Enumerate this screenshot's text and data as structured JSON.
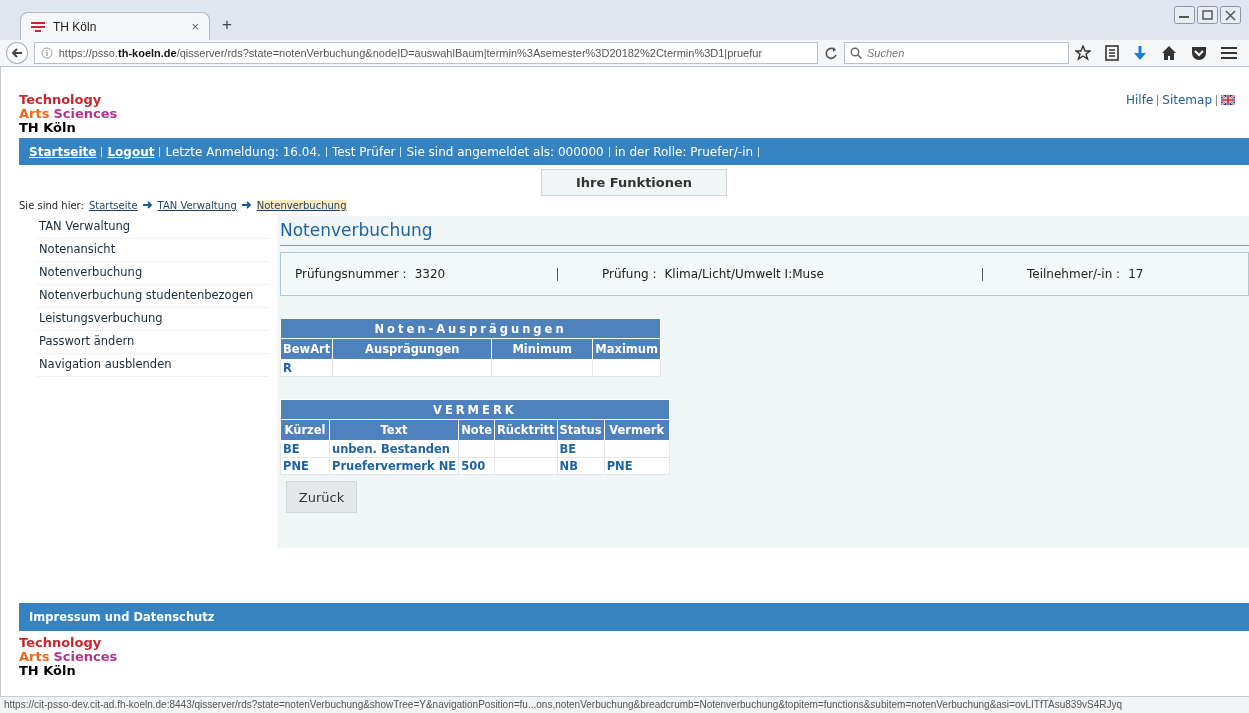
{
  "browser": {
    "tab_title": "TH Köln",
    "tab_close": "×",
    "new_tab": "+",
    "url": "https://psso.**th-koeln.de**/qisserver/rds?state=notenVerbuchung&nodeID=auswahlBaum|termin%3Asemester%3D20182%2Ctermin%3D1|pruefur",
    "search": {
      "placeholder": "Suchen"
    }
  },
  "logo": {
    "line1": "Technology",
    "word_arts": "Arts",
    "word_sciences": "Sciences",
    "name": "TH Köln"
  },
  "footer_logo": {
    "line1": "Technology",
    "word_arts": "Arts",
    "word_sciences": "Sciences",
    "name": "TH Köln"
  },
  "header_links": [
    "Hilfe",
    "Sitemap"
  ],
  "nav_bar": [
    {
      "kind": "link",
      "text": "Startseite"
    },
    {
      "kind": "link",
      "text": "Logout"
    },
    {
      "kind": "info",
      "text": "Letzte Anmeldung:  16.04."
    },
    {
      "kind": "info",
      "text": "Test Prüfer"
    },
    {
      "kind": "info",
      "text": "Sie sind angemeldet als: 000000"
    },
    {
      "kind": "info",
      "text": "in der Rolle: Pruefer/-in"
    }
  ],
  "functions_button": "Ihre Funktionen",
  "breadcrumb": {
    "label": "Sie sind hier:",
    "items": [
      {
        "text": "Startseite",
        "current": false
      },
      {
        "text": "TAN Verwaltung",
        "current": false
      },
      {
        "text": "Notenverbuchung",
        "current": true
      }
    ]
  },
  "sidebar": {
    "items": [
      "TAN Verwaltung",
      "Notenansicht",
      "Notenverbuchung",
      "Notenverbuchung studentenbezogen",
      "Leistungsverbuchung",
      "Passwort ändern",
      "Navigation ausblenden"
    ]
  },
  "content": {
    "title": "Notenverbuchung",
    "info": [
      {
        "label": "Prüfungsnummer :",
        "value": "3320"
      },
      {
        "label": "Prüfung :",
        "value": "Klima/Licht/Umwelt I:Muse"
      },
      {
        "label": "Teilnehmer/-in :",
        "value": "17"
      }
    ],
    "tables": [
      {
        "title": "Noten-Ausprägungen",
        "columns": [
          "BewArt",
          "Ausprägungen",
          "Minimum",
          "Maximum"
        ],
        "rows": [
          [
            "R",
            "",
            "",
            ""
          ]
        ]
      },
      {
        "title": "VERMERK",
        "columns": [
          "Kürzel",
          "Text",
          "Note",
          "Rücktritt",
          "Status",
          "Vermerk"
        ],
        "rows": [
          [
            "BE",
            "unben. Bestanden",
            "",
            "",
            "BE",
            ""
          ],
          [
            "PNE",
            "Pruefervermerk NE",
            "500",
            "",
            "NB",
            "PNE"
          ]
        ]
      }
    ],
    "back_button": "Zurück"
  },
  "footer": {
    "bar": "Impressum und Datenschutz"
  },
  "status_bar": "https://cit-psso-dev.cit-ad.fh-koeln.de:8443/qisserver/rds?state=notenVerbuchung&showTree=Y&navigationPosition=fu...ons,notenVerbuchung&breadcrumb=Notenverbuchung&topitem=functions&subitem=notenVerbuchung&asi=ovLITfTAsu839vS4RJyq"
}
